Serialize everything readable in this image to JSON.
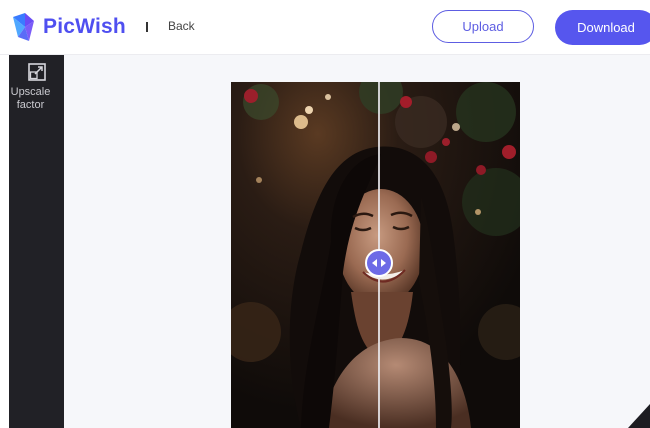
{
  "app": {
    "brand": "PicWish",
    "brand_color": "#4f4ff0"
  },
  "header": {
    "back_label": "Back",
    "upload_label": "Upload",
    "download_label": "Download",
    "accent": "#5656ee"
  },
  "sidebar": {
    "tools": [
      {
        "label": "Upscale\nfactor",
        "icon": "upscale-icon"
      }
    ]
  },
  "preview": {
    "compare_handle_icon": "left-right-arrows-icon",
    "image_description_icon": "photo"
  }
}
